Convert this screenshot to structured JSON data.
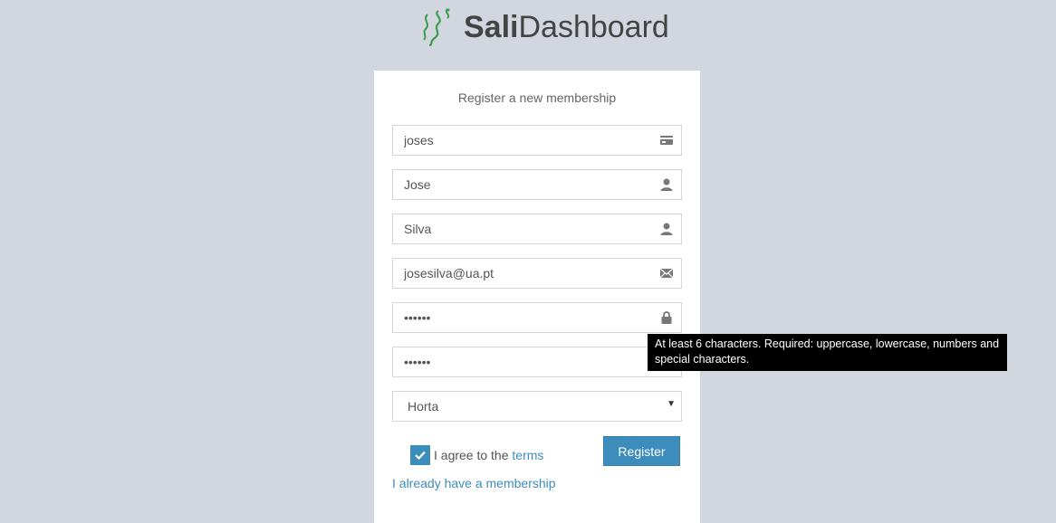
{
  "logo": {
    "bold": "Sali",
    "light": "Dashboard"
  },
  "form": {
    "message": "Register a new membership",
    "username": "joses",
    "first_name": "Jose",
    "last_name": "Silva",
    "email": "josesilva@ua.pt",
    "password": "••••••",
    "password_confirm": "••••••",
    "location": "Horta",
    "agree_prefix": "I agree to the ",
    "agree_link": "terms",
    "register_label": "Register",
    "member_link": "I already have a membership"
  },
  "tooltip": {
    "text": "At least 6 characters. Required: uppercase, lowercase, numbers and special characters."
  },
  "icons": {
    "username": "id-card-icon",
    "first_name": "user-icon",
    "last_name": "user-icon",
    "email": "envelope-icon",
    "password": "lock-icon",
    "select": "caret-down-icon",
    "checkbox": "check-icon"
  },
  "colors": {
    "accent": "#3c8dbc",
    "background": "#d2d6de",
    "logo_green": "#3a9d4d"
  }
}
